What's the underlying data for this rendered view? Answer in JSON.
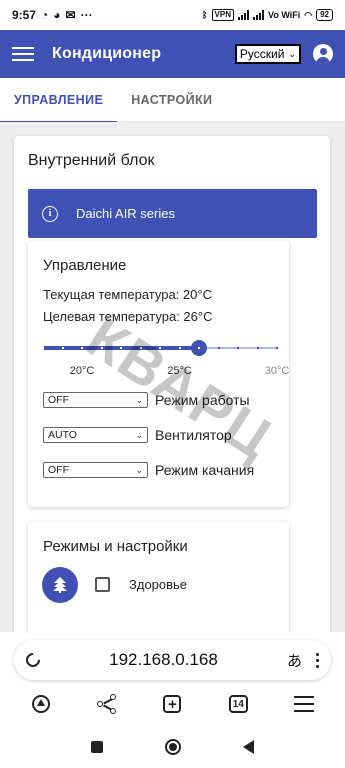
{
  "status_bar": {
    "time": "9:57",
    "vpn": "VPN",
    "wifi_label": "Vo WiFi",
    "battery": "92"
  },
  "app_bar": {
    "title": "Кондиционер",
    "language": "Русский"
  },
  "tabs": [
    {
      "label": "УПРАВЛЕНИЕ",
      "active": true
    },
    {
      "label": "НАСТРОЙКИ",
      "active": false
    }
  ],
  "indoor": {
    "title": "Внутренний блок",
    "info": "Daichi AIR series"
  },
  "control": {
    "title": "Управление",
    "current_temp": "Текущая температура: 20°C",
    "target_temp": "Целевая температура: 26°C",
    "slider": {
      "value": 26,
      "min": 18,
      "max": 30,
      "labels": [
        "20°C",
        "25°C",
        "30°C"
      ]
    },
    "rows": [
      {
        "value": "OFF",
        "label": "Режим работы"
      },
      {
        "value": "AUTO",
        "label": "Вентилятор"
      },
      {
        "value": "OFF",
        "label": "Режим качания"
      }
    ]
  },
  "modes": {
    "title": "Режимы и настройки",
    "health_label": "Здоровье"
  },
  "watermark": "КВАРЦ",
  "browser": {
    "url": "192.168.0.168",
    "translate_glyph": "あ",
    "tab_count": "14"
  },
  "colors": {
    "primary": "#3f51b5",
    "background": "#eeeeee"
  }
}
